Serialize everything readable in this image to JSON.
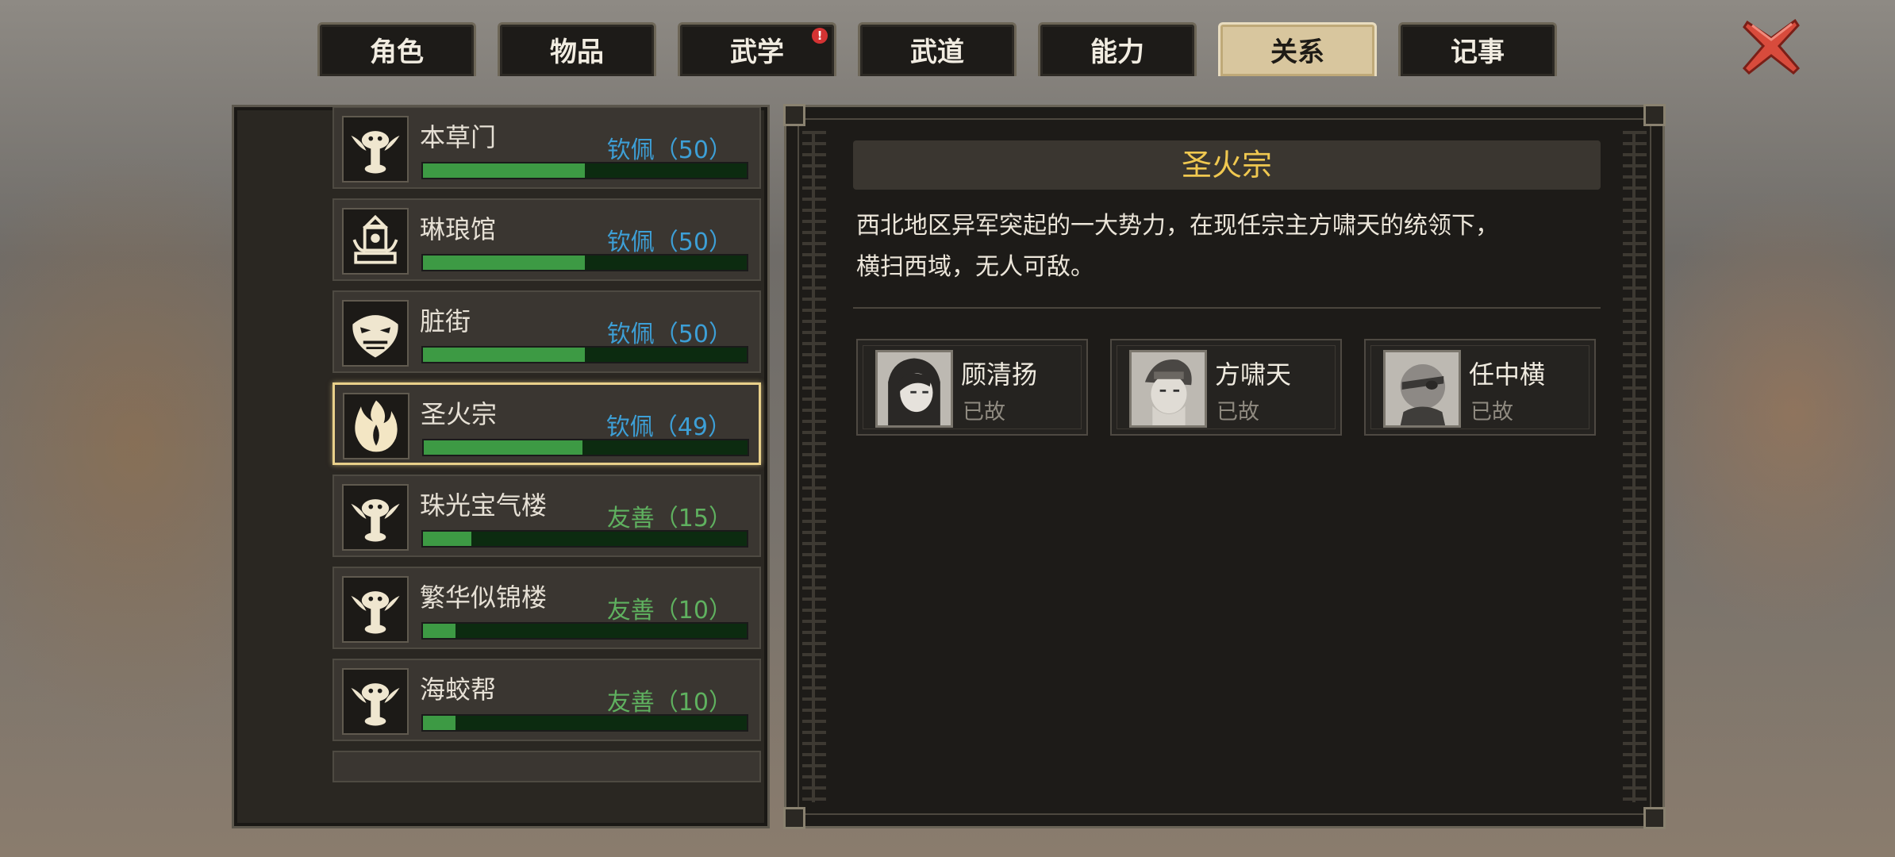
{
  "tabs": [
    {
      "label": "角色",
      "active": false
    },
    {
      "label": "物品",
      "active": false
    },
    {
      "label": "武学",
      "active": false,
      "notification": "!"
    },
    {
      "label": "武道",
      "active": false
    },
    {
      "label": "能力",
      "active": false
    },
    {
      "label": "关系",
      "active": true
    },
    {
      "label": "记事",
      "active": false
    }
  ],
  "factions": [
    {
      "name": "本草门",
      "status": "钦佩（50）",
      "level": 0.5,
      "emblem": "bat-icon"
    },
    {
      "name": "琳琅馆",
      "status": "钦佩（50）",
      "level": 0.5,
      "emblem": "pavilion-icon"
    },
    {
      "name": "脏街",
      "status": "钦佩（50）",
      "level": 0.5,
      "emblem": "beast-face-icon"
    },
    {
      "name": "圣火宗",
      "status": "钦佩（49）",
      "level": 0.49,
      "emblem": "flame-icon",
      "selected": true
    },
    {
      "name": "珠光宝气楼",
      "status": "友善（15）",
      "level": 0.15,
      "emblem": "bat-icon"
    },
    {
      "name": "繁华似锦楼",
      "status": "友善（10）",
      "level": 0.1,
      "emblem": "bat-icon"
    },
    {
      "name": "海蛟帮",
      "status": "友善（10）",
      "level": 0.1,
      "emblem": "bat-icon"
    }
  ],
  "detail": {
    "title": "圣火宗",
    "description_line1": "西北地区异军突起的一大势力，在现任宗主方啸天的统领下，",
    "description_line2": "横扫西域，无人可敌。",
    "members": [
      {
        "name": "顾清扬",
        "status": "已故"
      },
      {
        "name": "方啸天",
        "status": "已故"
      },
      {
        "name": "任中横",
        "status": "已故"
      }
    ]
  },
  "colors": {
    "admire": "#3d9fd6",
    "friendly": "#5fb15f",
    "title_gold": "#f0c850",
    "bar_fill": "#3d9a44",
    "selected_border": "#e9d08a"
  }
}
